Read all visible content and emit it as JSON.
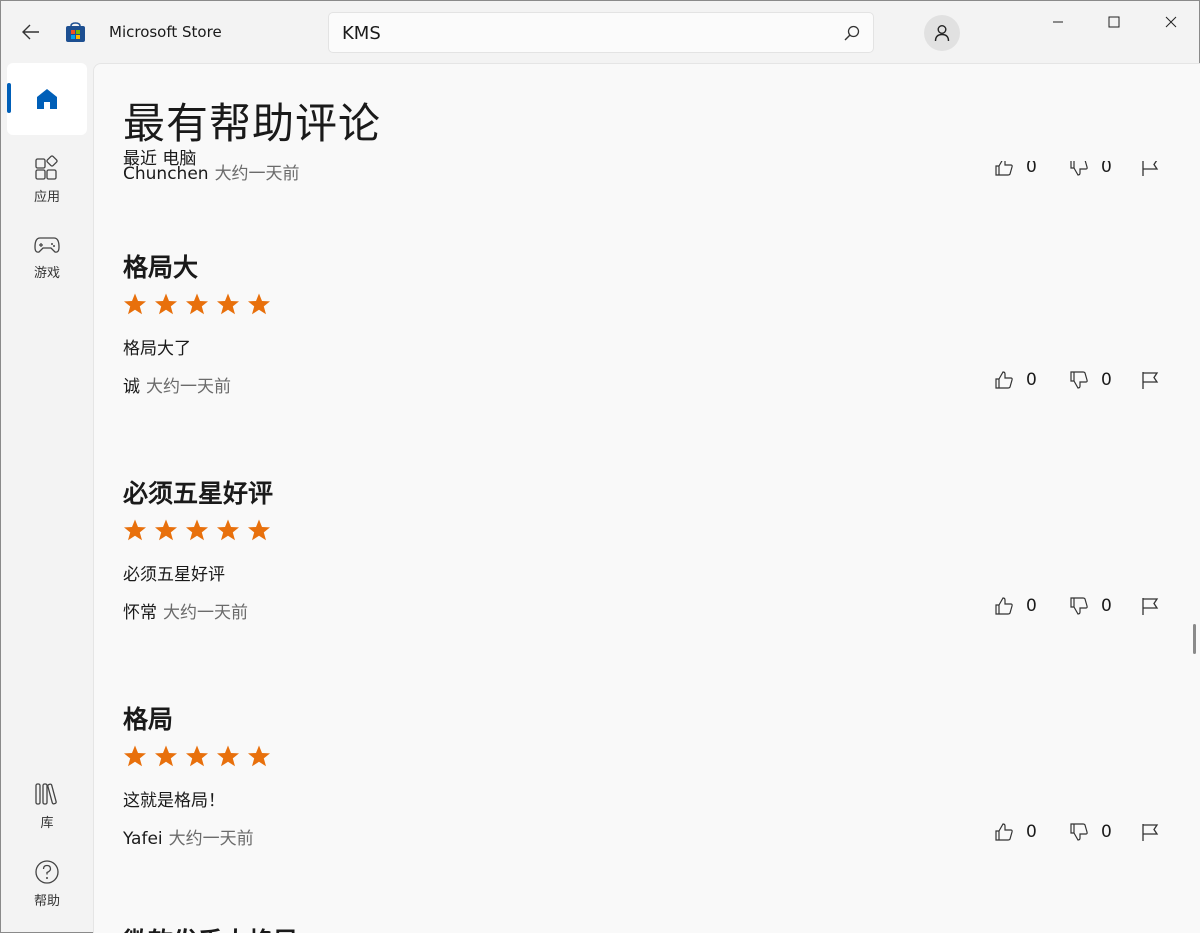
{
  "app": {
    "title": "Microsoft Store"
  },
  "search": {
    "query": "KMS"
  },
  "nav": {
    "apps_label": "应用",
    "games_label": "游戏",
    "library_label": "库",
    "help_label": "帮助"
  },
  "page": {
    "title": "最有帮助评论",
    "filter": "最近 电脑"
  },
  "partial_review": {
    "author": "Chunchen",
    "date": "大约一天前",
    "likes": "0",
    "dislikes": "0"
  },
  "reviews": [
    {
      "title": "格局大",
      "rating": 5,
      "body": "格局大了",
      "author": "诚",
      "date": "大约一天前",
      "likes": "0",
      "dislikes": "0"
    },
    {
      "title": "必须五星好评",
      "rating": 5,
      "body": "必须五星好评",
      "author": "怀常",
      "date": "大约一天前",
      "likes": "0",
      "dislikes": "0"
    },
    {
      "title": "格局",
      "rating": 5,
      "body": "这就是格局！",
      "author": "Yafei",
      "date": "大约一天前",
      "likes": "0",
      "dislikes": "0"
    }
  ],
  "partial_bottom_title": "微软发手大格局",
  "colors": {
    "star": "#e8700c",
    "accent": "#005fb8"
  }
}
